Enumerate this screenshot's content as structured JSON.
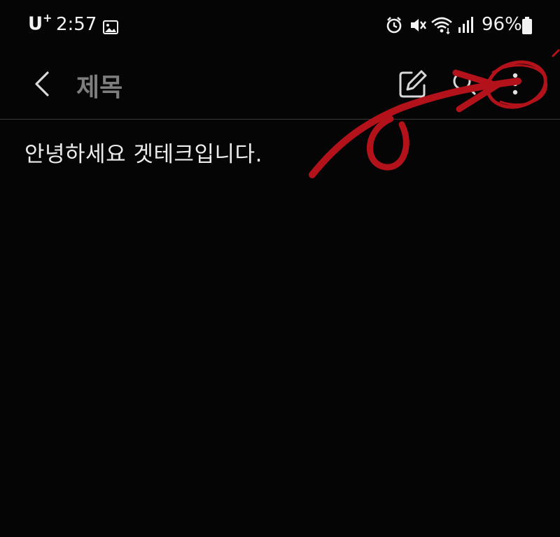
{
  "status_bar": {
    "carrier": "U",
    "carrier_sup": "+",
    "time": "2:57",
    "battery_percent": "96%",
    "icons": [
      "gallery-icon",
      "alarm-icon",
      "mute-icon",
      "wifi-icon",
      "signal-icon",
      "battery-icon"
    ]
  },
  "toolbar": {
    "title": "제목",
    "icons": [
      "back-icon",
      "edit-icon",
      "search-icon",
      "more-options-icon"
    ]
  },
  "note": {
    "body": "안녕하세요 겟테크입니다."
  },
  "colors": {
    "background": "#050505",
    "text": "#ececec",
    "title_placeholder": "#7e7e7e",
    "annotation": "#b3121b"
  }
}
